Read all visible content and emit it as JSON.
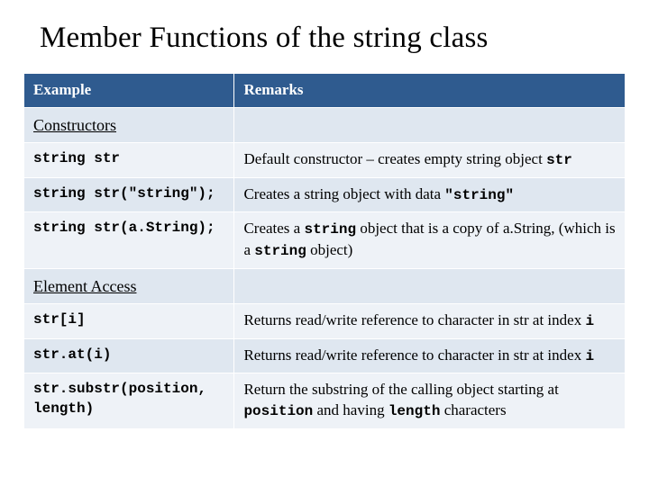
{
  "title": "Member Functions of the string class",
  "table": {
    "headers": [
      "Example",
      "Remarks"
    ],
    "sections": [
      {
        "title": "Constructors",
        "rows": [
          {
            "example": "string str",
            "remarks": [
              "Default constructor – creates empty string object ",
              "str"
            ]
          },
          {
            "example": "string str(\"string\");",
            "remarks": [
              "Creates a string object with data ",
              "\"string\""
            ]
          },
          {
            "example": "string str(a.String);",
            "remarks": [
              "Creates a ",
              "string",
              " object that is a copy of a.String, (which is a ",
              "string",
              " object)"
            ]
          }
        ]
      },
      {
        "title": "Element Access",
        "rows": [
          {
            "example": "str[i]",
            "remarks": [
              "Returns read/write reference to character in str at index ",
              "i"
            ]
          },
          {
            "example": "str.at(i)",
            "remarks": [
              "Returns read/write reference to character in str at index ",
              "i"
            ]
          },
          {
            "example": "str.substr(position, length)",
            "remarks": [
              "Return the substring of the calling object starting at ",
              "position",
              " and having ",
              "length",
              " characters"
            ]
          }
        ]
      }
    ]
  }
}
